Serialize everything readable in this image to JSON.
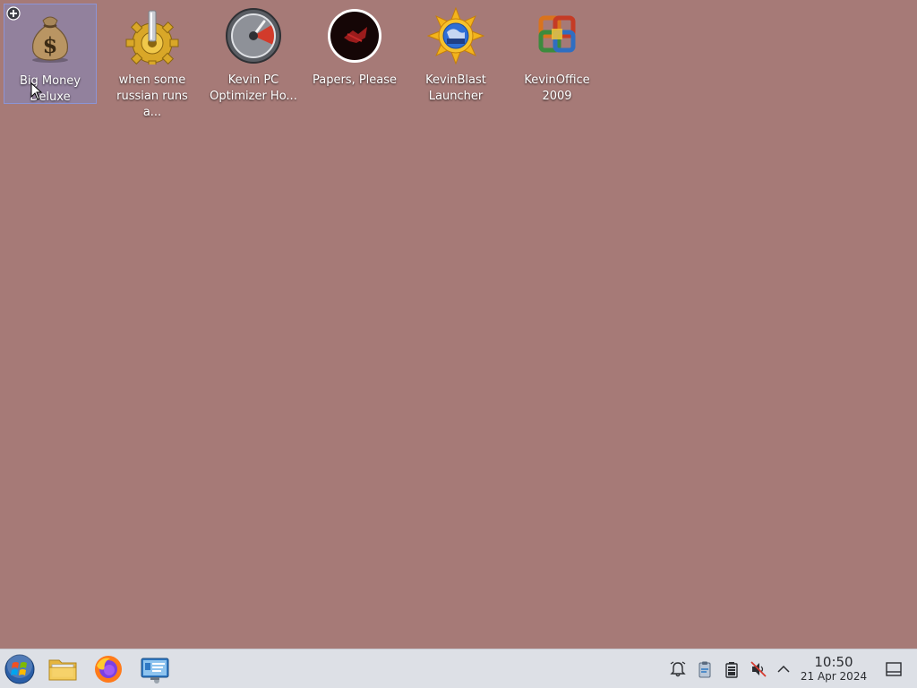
{
  "desktop": {
    "background": "#a67a77",
    "icons": [
      {
        "label": "Big Money Deluxe",
        "icon": "money-bag-icon",
        "selected": true
      },
      {
        "label": "when some russian runs a...",
        "icon": "gear-icon"
      },
      {
        "label": "Kevin PC Optimizer Ho...",
        "icon": "speedometer-icon"
      },
      {
        "label": "Papers, Please",
        "icon": "papers-please-icon"
      },
      {
        "label": "KevinBlast Launcher",
        "icon": "sun-globe-icon"
      },
      {
        "label": "KevinOffice 2009",
        "icon": "office-logo-icon"
      }
    ]
  },
  "taskbar": {
    "pinned": [
      "start-menu-button",
      "file-manager",
      "firefox",
      "system-settings"
    ],
    "tray": [
      "notifications-icon",
      "clipboard-icon",
      "battery-icon",
      "muted-volume-icon",
      "expand-tray-icon"
    ],
    "clock": {
      "time": "10:50",
      "date": "21 Apr 2024"
    }
  }
}
